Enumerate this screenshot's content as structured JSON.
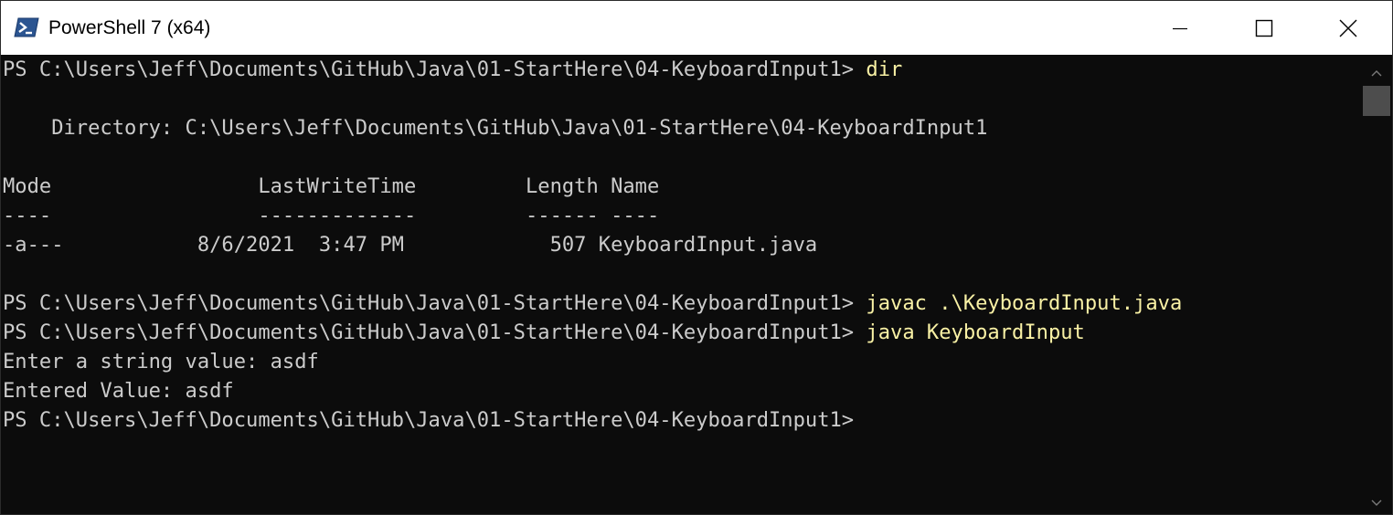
{
  "window": {
    "title": "PowerShell 7 (x64)",
    "icon": "powershell-icon",
    "controls": {
      "minimize_icon": "minimize-icon",
      "maximize_icon": "maximize-icon",
      "close_icon": "close-icon"
    }
  },
  "console": {
    "lines": [
      {
        "text": "PS C:\\Users\\Jeff\\Documents\\GitHub\\Java\\01-StartHere\\04-KeyboardInput1> ",
        "command": "dir"
      },
      {
        "text": "",
        "command": ""
      },
      {
        "text": "    Directory: C:\\Users\\Jeff\\Documents\\GitHub\\Java\\01-StartHere\\04-KeyboardInput1",
        "command": ""
      },
      {
        "text": "",
        "command": ""
      },
      {
        "text": "Mode                 LastWriteTime         Length Name",
        "command": ""
      },
      {
        "text": "----                 -------------         ------ ----",
        "command": ""
      },
      {
        "text": "-a---           8/6/2021  3:47 PM            507 KeyboardInput.java",
        "command": ""
      },
      {
        "text": "",
        "command": ""
      },
      {
        "text": "PS C:\\Users\\Jeff\\Documents\\GitHub\\Java\\01-StartHere\\04-KeyboardInput1> ",
        "command": "javac .\\KeyboardInput.java"
      },
      {
        "text": "PS C:\\Users\\Jeff\\Documents\\GitHub\\Java\\01-StartHere\\04-KeyboardInput1> ",
        "command": "java KeyboardInput"
      },
      {
        "text": "Enter a string value: asdf",
        "command": ""
      },
      {
        "text": "Entered Value: asdf",
        "command": ""
      },
      {
        "text": "PS C:\\Users\\Jeff\\Documents\\GitHub\\Java\\01-StartHere\\04-KeyboardInput1>",
        "command": ""
      }
    ]
  },
  "colors": {
    "background": "#0c0c0c",
    "foreground": "#cccccc",
    "command": "#f9f1a5",
    "titlebar": "#ffffff"
  }
}
